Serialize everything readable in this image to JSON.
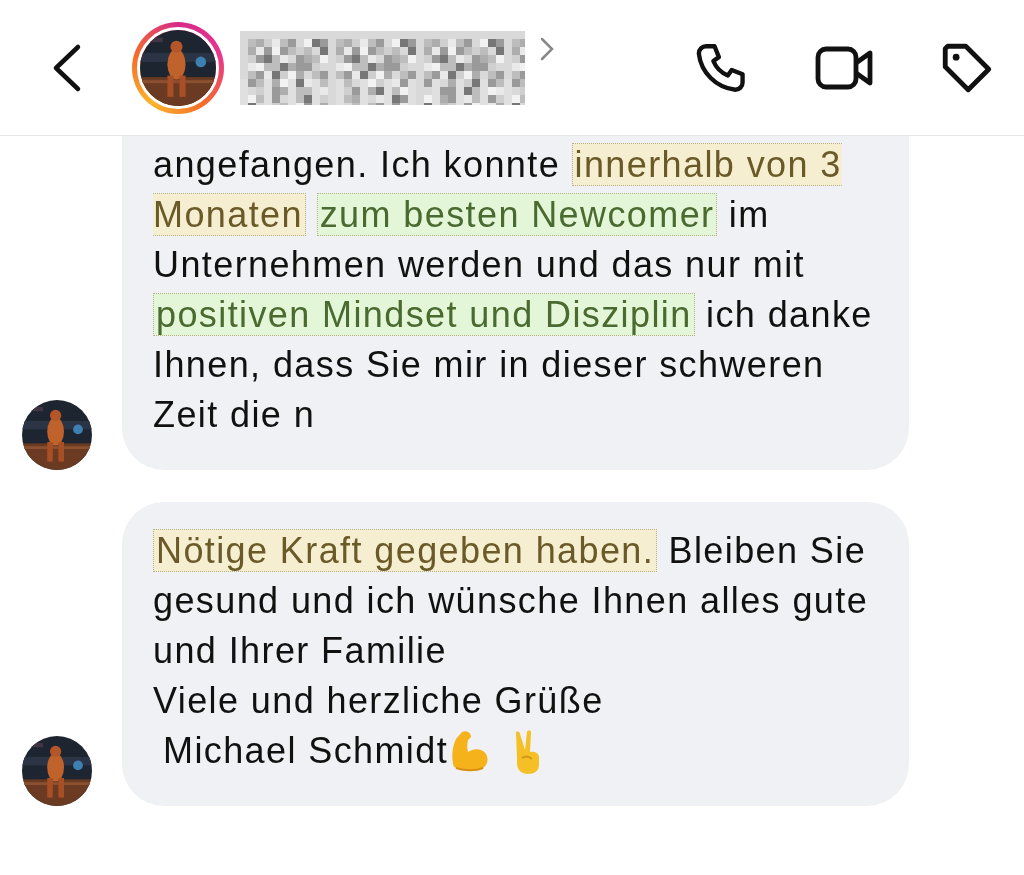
{
  "header": {
    "back": true,
    "has_story": true
  },
  "messages": [
    {
      "continued": true,
      "paragraphs": [
        [
          {
            "text": "angefangen. Ich konnte "
          },
          {
            "text": "innerhalb von 3 Monaten",
            "color": "#f6eed0"
          },
          {
            "text": "zum besten Newcomer",
            "color": "#e4f6d8"
          },
          {
            "text": " im Unternehmen werden und das nur mit "
          },
          {
            "text": "positiven Mindset und Disziplin",
            "color": "#e4f6d8"
          },
          {
            "text": " ich danke Ihnen, dass Sie mir in dieser schweren Zeit die n"
          }
        ]
      ]
    },
    {
      "continued": false,
      "paragraphs": [
        [
          {
            "text": "Nötige Kraft gegeben haben.",
            "color": "#f6eed0"
          },
          {
            "text": " Bleiben Sie gesund und ich wünsche Ihnen alles gute und Ihrer Familie"
          }
        ],
        [
          {
            "text": "Viele und herzliche Grüße"
          }
        ]
      ],
      "signature": "Michael Schmidt"
    }
  ]
}
